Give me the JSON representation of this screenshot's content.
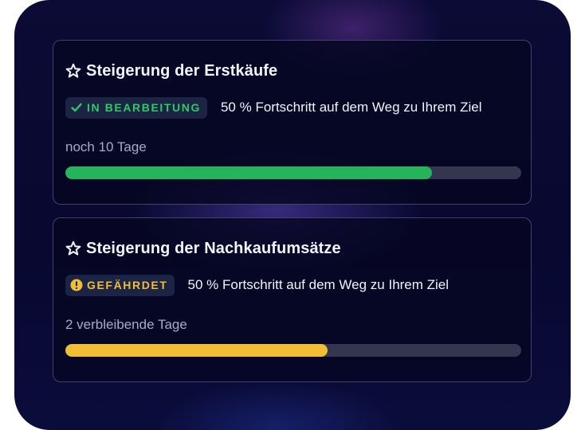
{
  "goals": [
    {
      "title": "Steigerung der Erstkäufe",
      "status": "IN BEARBEITUNG",
      "status_icon": "check-icon",
      "status_color": "#31c864",
      "progress_text": "50 % Fortschritt auf dem Weg zu Ihrem Ziel",
      "time_left": "noch 10 Tage",
      "bar_fill_fraction": 0.805,
      "bar_color": "#24b45a"
    },
    {
      "title": "Steigerung der Nachkaufumsätze",
      "status": "GEFÄHRDET",
      "status_icon": "alert-circle-icon",
      "status_color": "#f2be35",
      "progress_text": "50 % Fortschritt auf dem Weg zu Ihrem Ziel",
      "time_left": "2 verbleibende Tage",
      "bar_fill_fraction": 0.575,
      "bar_color": "#f2be35"
    }
  ],
  "colors": {
    "panel_background": "#080830",
    "track": "#34354f",
    "badge_background": "#1b2445"
  }
}
